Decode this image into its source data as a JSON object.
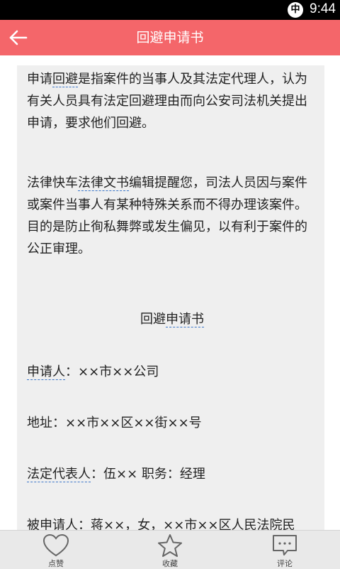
{
  "status_bar": {
    "ime_indicator": "中",
    "time": "9:44"
  },
  "app_bar": {
    "back_icon": "arrow-left-icon",
    "title": "回避申请书"
  },
  "article": {
    "para1": {
      "before": "申请",
      "term": "回避",
      "after": "是指案件的当事人及其法定代理人，认为有关人员具有法定回避理由而向公安司法机关提出申请，要求他们回避。"
    },
    "para2": {
      "brand": "法律快车",
      "term": "法律文书",
      "after": "编辑提醒您，司法人员因与案件或案件当事人有某种特殊关系而不得办理该案件。目的是防止徇私舞弊或发生偏见，以有利于案件的公正审理。"
    },
    "doc_title": {
      "before": "回避",
      "term": "申请书"
    },
    "applicant": {
      "term": "申请人",
      "after": "：××市××公司"
    },
    "address": "地址：××市××区××街××号",
    "legal_rep": {
      "term": "法定代表人",
      "after": "：伍×× 职务：经理"
    },
    "respondent": "被申请人：蒋××，女，××市××区人民法院民"
  },
  "bottom_bar": {
    "tabs": [
      {
        "label": "点赞",
        "icon": "heart-icon"
      },
      {
        "label": "收藏",
        "icon": "star-icon"
      },
      {
        "label": "评论",
        "icon": "comment-icon"
      }
    ]
  },
  "colors": {
    "accent": "#f4666a",
    "link_underline": "#3b76c9"
  }
}
